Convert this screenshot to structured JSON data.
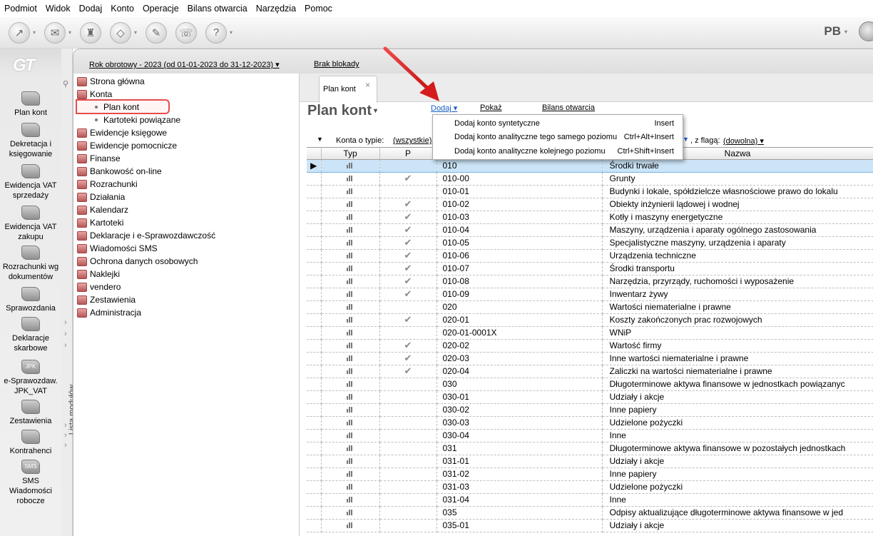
{
  "menubar": [
    "Podmiot",
    "Widok",
    "Dodaj",
    "Konto",
    "Operacje",
    "Bilans otwarcia",
    "Narzędzia",
    "Pomoc"
  ],
  "toolbar": {
    "user_initials": "PB",
    "dropdown_arrow": "▾"
  },
  "logo_text": "GT",
  "modules": [
    {
      "label": "Plan kont"
    },
    {
      "label": "Dekretacja i księgowanie"
    },
    {
      "label": "Ewidencja VAT sprzedaży"
    },
    {
      "label": "Ewidencja VAT zakupu"
    },
    {
      "label": "Rozrachunki wg dokumentów"
    },
    {
      "label": "Sprawozdania"
    },
    {
      "label": "Deklaracje skarbowe"
    },
    {
      "label": "e-Sprawozdaw. JPK_VAT",
      "icon_text": "JPK"
    },
    {
      "label": "Zestawienia"
    },
    {
      "label": "Kontrahenci"
    },
    {
      "label": "SMS Wiadomości robocze",
      "icon_text": "SMS"
    }
  ],
  "lista_modulow": "Lista modułów",
  "header": {
    "rok": "Rok obrotowy - 2023  (od 01-01-2023 do 31-12-2023)",
    "brak_blokady": "Brak blokady"
  },
  "nav": [
    {
      "label": "Strona główna"
    },
    {
      "label": "Konta"
    },
    {
      "label": "Plan kont",
      "sub": true
    },
    {
      "label": "Kartoteki powiązane",
      "sub": true
    },
    {
      "label": "Ewidencje księgowe"
    },
    {
      "label": "Ewidencje pomocnicze"
    },
    {
      "label": "Finanse"
    },
    {
      "label": "Bankowość on-line"
    },
    {
      "label": "Rozrachunki"
    },
    {
      "label": "Działania"
    },
    {
      "label": "Kalendarz"
    },
    {
      "label": "Kartoteki"
    },
    {
      "label": "Deklaracje i e-Sprawozdawczość"
    },
    {
      "label": "Wiadomości SMS"
    },
    {
      "label": "Ochrona danych osobowych"
    },
    {
      "label": "Naklejki"
    },
    {
      "label": "vendero"
    },
    {
      "label": "Zestawienia"
    },
    {
      "label": "Administracja"
    }
  ],
  "tab": {
    "label": "Plan kont",
    "close": "×"
  },
  "page_title": "Plan kont",
  "actions": {
    "dodaj": "Dodaj",
    "pokaz": "Pokaż",
    "bilans": "Bilans otwarcia"
  },
  "dodaj_menu": [
    {
      "label": "Dodaj konto syntetyczne",
      "shortcut": "Insert"
    },
    {
      "label": "Dodaj konto analityczne tego samego poziomu",
      "shortcut": "Ctrl+Alt+Insert"
    },
    {
      "label": "Dodaj konto analityczne kolejnego poziomu",
      "shortcut": "Ctrl+Shift+Insert"
    }
  ],
  "filter": {
    "konta_label": "Konta o typie:",
    "konta_value": "(wszystkie)",
    "flaga_label": ", z flagą:",
    "flaga_value": "(dowolna)"
  },
  "columns": [
    "Typ",
    "P",
    "Nazwa"
  ],
  "rows": [
    {
      "num": "010",
      "p": false,
      "name": "Środki trwałe"
    },
    {
      "num": "010-00",
      "p": true,
      "name": "Grunty"
    },
    {
      "num": "010-01",
      "p": false,
      "name": "Budynki i lokale, spółdzielcze własnościowe prawo do lokalu"
    },
    {
      "num": "010-02",
      "p": true,
      "name": "Obiekty inżynierii lądowej i wodnej"
    },
    {
      "num": "010-03",
      "p": true,
      "name": "Kotły i maszyny energetyczne"
    },
    {
      "num": "010-04",
      "p": true,
      "name": "Maszyny, urządzenia i aparaty ogólnego zastosowania"
    },
    {
      "num": "010-05",
      "p": true,
      "name": "Specjalistyczne maszyny, urządzenia i aparaty"
    },
    {
      "num": "010-06",
      "p": true,
      "name": "Urządzenia techniczne"
    },
    {
      "num": "010-07",
      "p": true,
      "name": "Środki transportu"
    },
    {
      "num": "010-08",
      "p": true,
      "name": "Narzędzia, przyrządy, ruchomości i wyposażenie"
    },
    {
      "num": "010-09",
      "p": true,
      "name": "Inwentarz żywy"
    },
    {
      "num": "020",
      "p": false,
      "name": "Wartości niematerialne i prawne"
    },
    {
      "num": "020-01",
      "p": true,
      "name": "Koszty zakończonych prac rozwojowych"
    },
    {
      "num": "020-01-0001X",
      "p": false,
      "name": "WNiP"
    },
    {
      "num": "020-02",
      "p": true,
      "name": "Wartość firmy"
    },
    {
      "num": "020-03",
      "p": true,
      "name": "Inne wartości niematerialne i prawne"
    },
    {
      "num": "020-04",
      "p": true,
      "name": "Zaliczki na wartości niematerialne i prawne"
    },
    {
      "num": "030",
      "p": false,
      "name": "Długoterminowe aktywa finansowe w jednostkach powiązanyc"
    },
    {
      "num": "030-01",
      "p": false,
      "name": "Udziały i akcje"
    },
    {
      "num": "030-02",
      "p": false,
      "name": "Inne papiery"
    },
    {
      "num": "030-03",
      "p": false,
      "name": "Udzielone pożyczki"
    },
    {
      "num": "030-04",
      "p": false,
      "name": "Inne"
    },
    {
      "num": "031",
      "p": false,
      "name": "Długoterminowe aktywa finansowe w pozostałych jednostkach"
    },
    {
      "num": "031-01",
      "p": false,
      "name": "Udziały i akcje"
    },
    {
      "num": "031-02",
      "p": false,
      "name": "Inne papiery"
    },
    {
      "num": "031-03",
      "p": false,
      "name": "Udzielone pożyczki"
    },
    {
      "num": "031-04",
      "p": false,
      "name": "Inne"
    },
    {
      "num": "035",
      "p": false,
      "name": "Odpisy aktualizujące długoterminowe aktywa finansowe w jed"
    },
    {
      "num": "035-01",
      "p": false,
      "name": "Udziały i akcje"
    }
  ],
  "colors": {
    "highlight": "#e84b4b",
    "link": "#1a5fc6",
    "selection": "#cce4f7"
  }
}
